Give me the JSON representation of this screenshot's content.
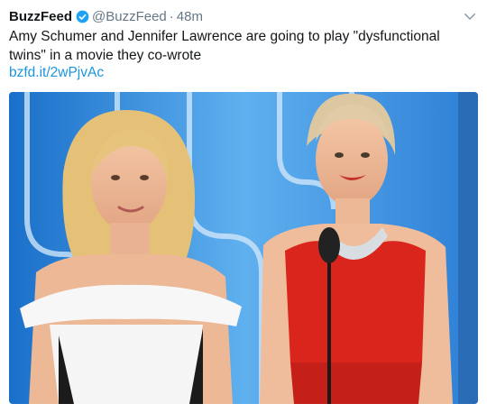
{
  "tweet": {
    "display_name": "BuzzFeed",
    "handle": "@BuzzFeed",
    "separator": "·",
    "time": "48m",
    "text": "Amy Schumer and Jennifer Lawrence are going to play \"dysfunctional twins\" in a movie they co-wrote",
    "link": "bzfd.it/2wPjvAc",
    "verified_icon": "verified-badge-icon",
    "menu_icon": "chevron-down-icon",
    "colors": {
      "link": "#1b95e0",
      "verified": "#1da1f2",
      "muted": "#657786"
    }
  }
}
